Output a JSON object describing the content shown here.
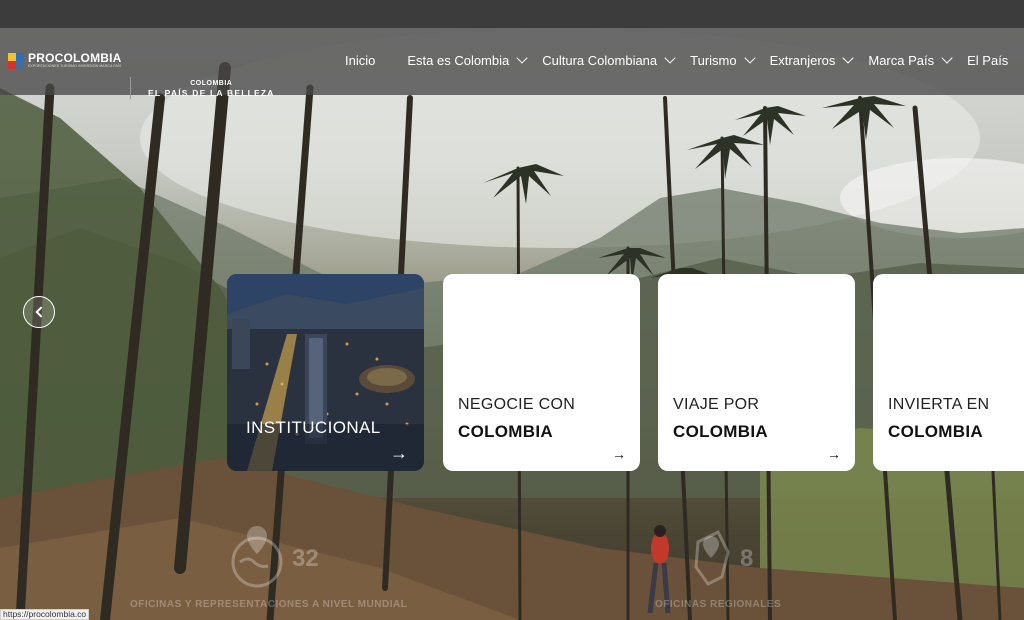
{
  "header": {
    "logo_text": "PROCOLOMBIA",
    "logo_tagline": "EXPORTACIONES TURISMO INVERSIÓN MARCA PAÍS",
    "brand_line1": "COLOMBIA",
    "brand_line2": "EL PAÍS DE LA BELLEZA"
  },
  "nav": {
    "items": [
      {
        "label": "Inicio",
        "has_dropdown": false
      },
      {
        "label": "Esta es Colombia",
        "has_dropdown": true
      },
      {
        "label": "Cultura Colombiana",
        "has_dropdown": true
      },
      {
        "label": "Turismo",
        "has_dropdown": true
      },
      {
        "label": "Extranjeros",
        "has_dropdown": true
      },
      {
        "label": "Marca País",
        "has_dropdown": true
      },
      {
        "label": "El País",
        "has_dropdown": false
      }
    ]
  },
  "carousel": {
    "cards": [
      {
        "line1": "INSTITUCIONAL",
        "line2": ""
      },
      {
        "line1": "NEGOCIE CON",
        "line2": "COLOMBIA"
      },
      {
        "line1": "VIAJE POR",
        "line2": "COLOMBIA"
      },
      {
        "line1": "INVIERTA EN",
        "line2": "COLOMBIA"
      }
    ],
    "arrow_glyph": "→",
    "prev_icon": "chevron-left-icon"
  },
  "stats": [
    {
      "value": "32",
      "label": "OFICINAS Y REPRESENTACIONES A NIVEL MUNDIAL",
      "icon": "world-map-pin-icon"
    },
    {
      "value": "8",
      "label": "OFICINAS REGIONALES",
      "icon": "colombia-map-pin-icon"
    }
  ],
  "status_url": "https://procolombia.co",
  "colors": {
    "nav_bg": "#484848",
    "card_bg": "#ffffff",
    "logo_blue": "#2f6fb5",
    "logo_yellow": "#f2c230",
    "logo_red": "#d6332c"
  }
}
